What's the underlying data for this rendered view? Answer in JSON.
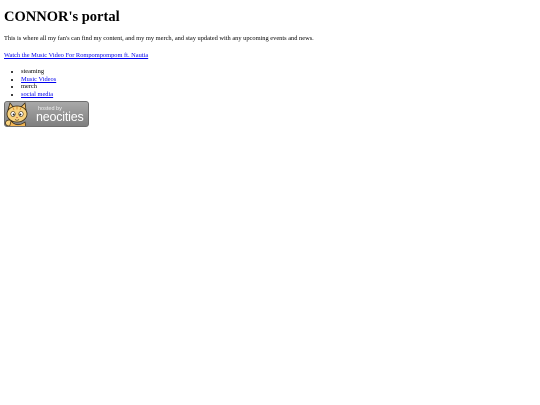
{
  "page": {
    "title": "CONNOR's portal",
    "intro": "This is where all my fan's can find my content, and my my merch, and stay updated with any upcoming events and news.",
    "video_link": "Watch the Music Video For Rompompompom ft. Nautia"
  },
  "menu": {
    "items": [
      {
        "label": "steaming",
        "is_link": false
      },
      {
        "label": "Music Videos",
        "is_link": true
      },
      {
        "label": "merch",
        "is_link": false
      },
      {
        "label": "social media",
        "is_link": true
      }
    ]
  },
  "badge": {
    "hosted_by": "hosted by",
    "brand": "neocities",
    "icon": "neocities-cat-icon"
  },
  "colors": {
    "link": "#0000ee",
    "text": "#000000",
    "badge_bg": "#8f8f8f"
  }
}
